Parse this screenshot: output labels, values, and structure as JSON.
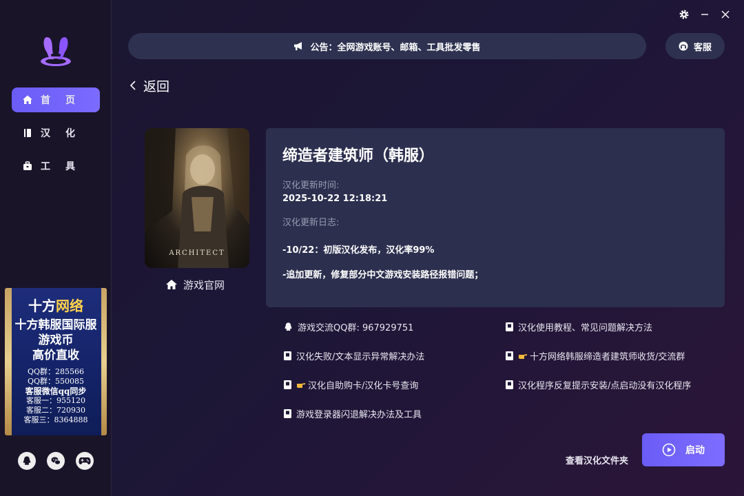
{
  "sidebar": {
    "nav": [
      {
        "label": "首页",
        "icon": "home-icon",
        "active": true
      },
      {
        "label": "汉化",
        "icon": "book-icon",
        "active": false
      },
      {
        "label": "工具",
        "icon": "toolbox-icon",
        "active": false
      }
    ],
    "ad": {
      "brand_white": "十方",
      "brand_yellow": "网络",
      "line1": "十方韩服国际服",
      "line2": "游戏币",
      "line3": "高价直收",
      "qq1": "QQ群：285566",
      "qq2": "QQ群：550085",
      "wechat": "客服微信qq同步",
      "cs1": "客服一：955120",
      "cs2": "客服二：720930",
      "cs3": "客服三：8364888"
    },
    "social": [
      "qq-icon",
      "wechat-icon",
      "gamepad-icon"
    ]
  },
  "header": {
    "announcement": "公告：全网游戏账号、邮箱、工具批发零售",
    "service_label": "客服"
  },
  "back_label": "返回",
  "game": {
    "cover_text": "ARCHITECT",
    "official_site": "游戏官网",
    "title": "缔造者建筑师（韩服）",
    "update_time_label": "汉化更新时间:",
    "update_time": "2025-10-22 12:18:21",
    "changelog_label": "汉化更新日志:",
    "changelog": [
      "-10/22：初版汉化发布，汉化率99%",
      "-追加更新，修复部分中文游戏安装路径报错问题；"
    ]
  },
  "links": {
    "qq_group": "游戏交流QQ群: 967929751",
    "tutorial": "汉化使用教程、常见问题解决方法",
    "fail_fix": "汉化失败/文本显示异常解决办法",
    "recycle": "十方网络韩服缔造者建筑师收货/交流群",
    "purchase": "汉化自助购卡/汉化卡号查询",
    "reinstall": "汉化程序反复提示安装/点启动没有汉化程序",
    "launcher_crash": "游戏登录器闪退解决办法及工具"
  },
  "footer": {
    "folder_label": "查看汉化文件夹",
    "launch_label": "启动"
  },
  "colors": {
    "accent": "#6a5cf6",
    "card": "#2c2f4e",
    "sidebar": "#1a1429"
  }
}
